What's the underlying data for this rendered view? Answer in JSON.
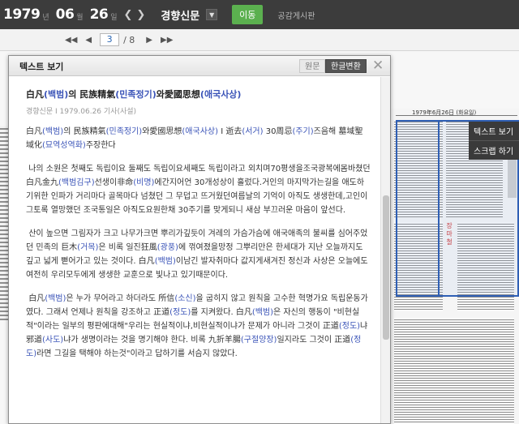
{
  "topbar": {
    "year": "1979",
    "year_unit": "년",
    "month": "06",
    "month_unit": "월",
    "day": "26",
    "day_unit": "일",
    "newspaper": "경향신문",
    "go_button": "이동",
    "board_link": "공감게시판"
  },
  "pager": {
    "current_page": "3",
    "separator_total": "/ 8"
  },
  "viewer": {
    "scan_header": "1979年6月26日 (화요일)",
    "scan_column_text": "장마철",
    "context_menu": [
      "텍스트 보기",
      "스크랩 하기"
    ]
  },
  "modal": {
    "title": "텍스트 보기",
    "tab_original": "원문",
    "tab_hangul": "한글변환",
    "article": {
      "title": [
        {
          "t": "白凡"
        },
        {
          "t": "(백범)",
          "c": true
        },
        {
          "t": "의 民族精氣"
        },
        {
          "t": "(민족정기)",
          "c": true
        },
        {
          "t": "와愛國思想"
        },
        {
          "t": "(애국사상)",
          "c": true
        }
      ],
      "meta": "경향신문 I 1979.06.26 기사(사설)",
      "subtitle": [
        {
          "t": "白凡"
        },
        {
          "t": "(백범)",
          "c": true
        },
        {
          "t": "의 民族精氣"
        },
        {
          "t": "(민족정기)",
          "c": true
        },
        {
          "t": "와愛國思想"
        },
        {
          "t": "(애국사상)",
          "c": true
        },
        {
          "t": " I 逝去"
        },
        {
          "t": "(서거)",
          "c": true
        },
        {
          "t": " 30周忌"
        },
        {
          "t": "(주기)",
          "c": true
        },
        {
          "t": "즈음해 墓域聖域化"
        },
        {
          "t": "(묘역성역화)",
          "c": true
        },
        {
          "t": "주장한다"
        }
      ],
      "paragraphs": [
        [
          {
            "t": "나의 소원은 첫째도 독립이요 둘째도 독립이요세째도 독립이라고 외치며70평생을조국광복에몸바쳤던白凡金九"
          },
          {
            "t": "(백범김구)",
            "c": true
          },
          {
            "t": "선생이非命"
          },
          {
            "t": "(비명)",
            "c": true
          },
          {
            "t": "에간지어언 30개성상이 흘렀다.거인의 마지막가는길을 애도하기위한 인파가 거리마다 골목마다 넘쳤던 그 무덥고 뜨거웠던여름날의 기억이 아직도 생생한데,고인이 그토록 열망했던 조국통일은 아직도요원한채 30주기를 맞게되니 새삼 부끄러운 마음이 앞선다."
          }
        ],
        [
          {
            "t": "산이 높으면 그림자가 크고 나무가크면 뿌리가깊듯이 겨레의 가슴가슴에 애국애족의 불씨를 심어주었던 민족의 巨木"
          },
          {
            "t": "(거목)",
            "c": true
          },
          {
            "t": "은 비록 일진狂風"
          },
          {
            "t": "(광풍)",
            "c": true
          },
          {
            "t": "에 꺾여졌을망정 그뿌리만은 한세대가 지난 오늘까지도 깊고 넓게 뻗어가고 있는 것이다. 白凡"
          },
          {
            "t": "(백범)",
            "c": true
          },
          {
            "t": "이남긴 발자취마다 값지게새겨진 정신과 사상은 오늘에도 여전히 우리모두에게 생생한 교훈으로 빛나고 있기때문이다."
          }
        ],
        [
          {
            "t": "白凡"
          },
          {
            "t": "(백범)",
            "c": true
          },
          {
            "t": "은 누가 무어라고 하더라도 所信"
          },
          {
            "t": "(소신)",
            "c": true
          },
          {
            "t": "을 굽히지 않고 원칙을 고수한 혁명가요 독립운동가였다. 그래서 언제나 원칙을 강조하고 正道"
          },
          {
            "t": "(정도)",
            "c": true
          },
          {
            "t": "를 지켜왔다. 白凡"
          },
          {
            "t": "(백범)",
            "c": true
          },
          {
            "t": "은 자신의 행동이 \"비현실적\"이라는 일부의 평판에대해\"우리는 현실적이냐,비현실적이냐가 문제가 아니라 그것이 正道"
          },
          {
            "t": "(정도)",
            "c": true
          },
          {
            "t": "냐 邪道"
          },
          {
            "t": "(사도)",
            "c": true
          },
          {
            "t": "냐가 생명이라는 것을 명기해야 한다. 비록 九折羊腸"
          },
          {
            "t": "(구절양장)",
            "c": true
          },
          {
            "t": "일지라도 그것이 正道"
          },
          {
            "t": "(정",
            "c": true
          },
          {
            "t": "도)",
            "c": true
          },
          {
            "t": "라면 그길을 택해야 하는것\"이라고 답하기를 서슴지 않았다."
          }
        ]
      ]
    }
  },
  "colors": {
    "topbar_bg": "#3c3c3c",
    "go_button": "#5bb04f",
    "hangul_reading": "#3b54b8",
    "selection": "#2f5fb4"
  }
}
